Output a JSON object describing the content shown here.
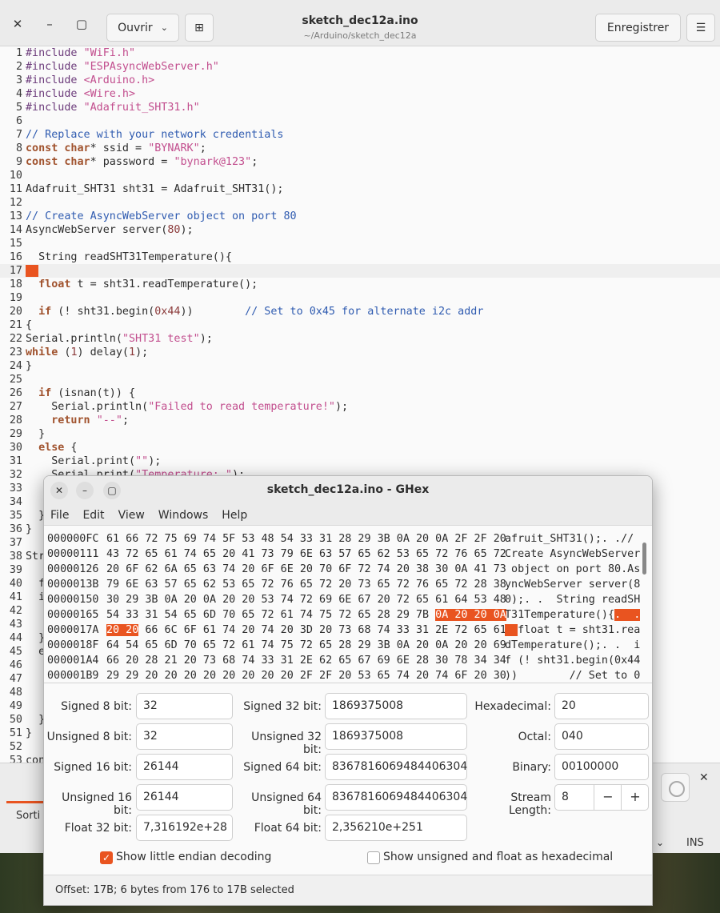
{
  "editor": {
    "title": "sketch_dec12a.ino",
    "subtitle": "~/Arduino/sketch_dec12a",
    "open_label": "Ouvrir",
    "save_label": "Enregistrer",
    "code": [
      {
        "n": "1",
        "t": "#include \"WiFi.h\""
      },
      {
        "n": "2",
        "t": "#include \"ESPAsyncWebServer.h\""
      },
      {
        "n": "3",
        "t": "#include <Arduino.h>"
      },
      {
        "n": "4",
        "t": "#include <Wire.h>"
      },
      {
        "n": "5",
        "t": "#include \"Adafruit_SHT31.h\""
      },
      {
        "n": "6",
        "t": ""
      },
      {
        "n": "7",
        "t": "// Replace with your network credentials"
      },
      {
        "n": "8",
        "t": "const char* ssid = \"BYNARK\";"
      },
      {
        "n": "9",
        "t": "const char* password = \"bynark@123\";"
      },
      {
        "n": "10",
        "t": ""
      },
      {
        "n": "11",
        "t": "Adafruit_SHT31 sht31 = Adafruit_SHT31();"
      },
      {
        "n": "12",
        "t": ""
      },
      {
        "n": "13",
        "t": "// Create AsyncWebServer object on port 80"
      },
      {
        "n": "14",
        "t": "AsyncWebServer server(80);"
      },
      {
        "n": "15",
        "t": ""
      },
      {
        "n": "16",
        "t": "  String readSHT31Temperature(){"
      },
      {
        "n": "17",
        "t": ""
      },
      {
        "n": "18",
        "t": "  float t = sht31.readTemperature();"
      },
      {
        "n": "19",
        "t": ""
      },
      {
        "n": "20",
        "t": "  if (! sht31.begin(0x44))        // Set to 0x45 for alternate i2c addr"
      },
      {
        "n": "21",
        "t": "{"
      },
      {
        "n": "22",
        "t": "Serial.println(\"SHT31 test\");"
      },
      {
        "n": "23",
        "t": "while (1) delay(1);"
      },
      {
        "n": "24",
        "t": "}"
      },
      {
        "n": "25",
        "t": ""
      },
      {
        "n": "26",
        "t": "  if (isnan(t)) {"
      },
      {
        "n": "27",
        "t": "    Serial.println(\"Failed to read temperature!\");"
      },
      {
        "n": "28",
        "t": "    return \"--\";"
      },
      {
        "n": "29",
        "t": "  }"
      },
      {
        "n": "30",
        "t": "  else {"
      },
      {
        "n": "31",
        "t": "    Serial.print(\"\");"
      },
      {
        "n": "32",
        "t": "    Serial.print(\"Temperature: \");"
      },
      {
        "n": "33",
        "t": ""
      },
      {
        "n": "34",
        "t": ""
      },
      {
        "n": "35",
        "t": "  }"
      },
      {
        "n": "36",
        "t": "}"
      },
      {
        "n": "37",
        "t": ""
      },
      {
        "n": "38",
        "t": "Str"
      },
      {
        "n": "39",
        "t": ""
      },
      {
        "n": "40",
        "t": "  f"
      },
      {
        "n": "41",
        "t": "  i"
      },
      {
        "n": "42",
        "t": ""
      },
      {
        "n": "43",
        "t": ""
      },
      {
        "n": "44",
        "t": "  }"
      },
      {
        "n": "45",
        "t": "  e"
      },
      {
        "n": "46",
        "t": ""
      },
      {
        "n": "47",
        "t": ""
      },
      {
        "n": "48",
        "t": ""
      },
      {
        "n": "49",
        "t": ""
      },
      {
        "n": "50",
        "t": "  }"
      },
      {
        "n": "51",
        "t": "}"
      },
      {
        "n": "52",
        "t": ""
      },
      {
        "n": "53",
        "t": "con"
      }
    ],
    "bottom_tab": "Sorti",
    "ins_label": "INS"
  },
  "ghex": {
    "title": "sketch_dec12a.ino - GHex",
    "menu": [
      "File",
      "Edit",
      "View",
      "Windows",
      "Help"
    ],
    "rows": [
      {
        "off": "000000FC",
        "bytes": "61 66 72 75 69 74 5F 53 48 54 33 31 28 29 3B 0A 20 0A 2F 2F 20",
        "ascii": "afruit_SHT31();. .// "
      },
      {
        "off": "00000111",
        "bytes": "43 72 65 61 74 65 20 41 73 79 6E 63 57 65 62 53 65 72 76 65 72",
        "ascii": "Create AsyncWebServer"
      },
      {
        "off": "00000126",
        "bytes": "20 6F 62 6A 65 63 74 20 6F 6E 20 70 6F 72 74 20 38 30 0A 41 73",
        "ascii": " object on port 80.As"
      },
      {
        "off": "0000013B",
        "bytes": "79 6E 63 57 65 62 53 65 72 76 65 72 20 73 65 72 76 65 72 28 38",
        "ascii": "yncWebServer server(8"
      },
      {
        "off": "00000150",
        "bytes": "30 29 3B 0A 20 0A 20 20 53 74 72 69 6E 67 20 72 65 61 64 53 48",
        "ascii": "0);. .  String readSH"
      },
      {
        "off": "00000165",
        "bytes": "54 33 31 54 65 6D 70 65 72 61 74 75 72 65 28 29 7B ",
        "hl": "0A 20 20 0A",
        "ascii": "T31Temperature(){",
        "ascii_hl": ".  ."
      },
      {
        "off": "0000017A",
        "hl_pre": "20 20",
        "bytes": " 66 6C 6F 61 74 20 74 20 3D 20 73 68 74 33 31 2E 72 65 61",
        "ascii_hl_pre": "  ",
        "ascii": "float t = sht31.rea"
      },
      {
        "off": "0000018F",
        "bytes": "64 54 65 6D 70 65 72 61 74 75 72 65 28 29 3B 0A 20 0A 20 20 69",
        "ascii": "dTemperature();. .  i"
      },
      {
        "off": "000001A4",
        "bytes": "66 20 28 21 20 73 68 74 33 31 2E 62 65 67 69 6E 28 30 78 34 34",
        "ascii": "f (! sht31.begin(0x44"
      },
      {
        "off": "000001B9",
        "bytes": "29 29 20 20 20 20 20 20 20 20 2F 2F 20 53 65 74 20 74 6F 20 30",
        "ascii": "))        // Set to 0"
      }
    ],
    "fields": {
      "signed8_label": "Signed 8 bit:",
      "signed8": "32",
      "unsigned8_label": "Unsigned 8 bit:",
      "unsigned8": "32",
      "signed16_label": "Signed 16 bit:",
      "signed16": "26144",
      "unsigned16_label": "Unsigned 16 bit:",
      "unsigned16": "26144",
      "float32_label": "Float 32 bit:",
      "float32": "7,316192e+28",
      "signed32_label": "Signed 32 bit:",
      "signed32": "1869375008",
      "unsigned32_label": "Unsigned 32 bit:",
      "unsigned32": "1869375008",
      "signed64_label": "Signed 64 bit:",
      "signed64": "8367816069484406304",
      "unsigned64_label": "Unsigned 64 bit:",
      "unsigned64": "8367816069484406304",
      "float64_label": "Float 64 bit:",
      "float64": "2,356210e+251",
      "hex_label": "Hexadecimal:",
      "hex": "20",
      "octal_label": "Octal:",
      "octal": "040",
      "binary_label": "Binary:",
      "binary": "00100000",
      "stream_label": "Stream Length:",
      "stream": "8"
    },
    "little_endian_label": "Show little endian decoding",
    "unsigned_hex_label": "Show unsigned and float as hexadecimal",
    "status": "Offset: 17B; 6 bytes from 176 to 17B selected"
  }
}
